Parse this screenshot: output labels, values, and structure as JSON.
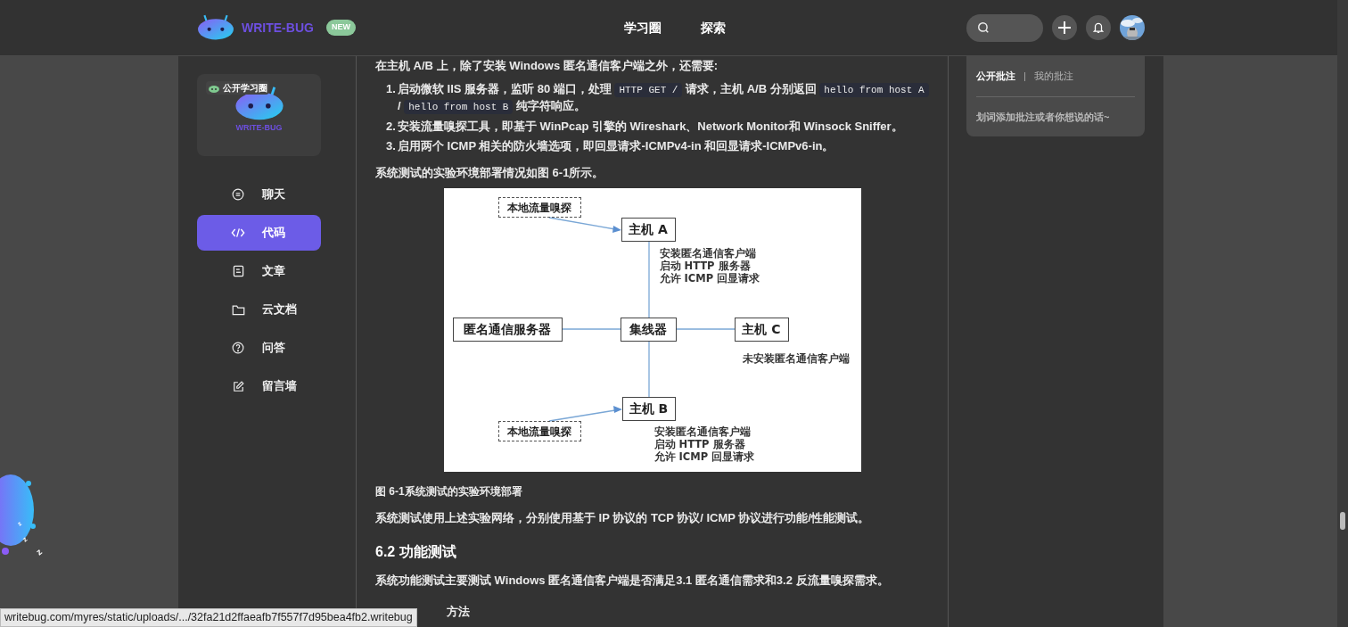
{
  "header": {
    "brand": "WRITE-BUG",
    "badge": "NEW",
    "nav": [
      {
        "label": "学习圈",
        "selected": false
      },
      {
        "label": "探索",
        "selected": false
      }
    ]
  },
  "sidebar": {
    "card": {
      "tag": "公开学习圈",
      "logo_text": "WRITE-BUG"
    },
    "items": [
      {
        "label": "聊天",
        "selected": false
      },
      {
        "label": "代码",
        "selected": true
      },
      {
        "label": "文章",
        "selected": false
      },
      {
        "label": "云文档",
        "selected": false
      },
      {
        "label": "问答",
        "selected": false
      },
      {
        "label": "留言墙",
        "selected": false
      }
    ]
  },
  "article": {
    "intro": "在主机 A/B 上，除了安装 Windows 匿名通信客户端之外，还需要:",
    "list": [
      {
        "number": "1.",
        "segments": [
          {
            "kind": "text",
            "text": "启动微软 IIS 服务器，监听 80 端口，处理 "
          },
          {
            "kind": "code",
            "text": "HTTP GET /"
          },
          {
            "kind": "text",
            "text": " 请求，主机 A/B 分别返回 "
          },
          {
            "kind": "code",
            "text": "hello from host A"
          },
          {
            "kind": "text",
            "text": " / "
          },
          {
            "kind": "code",
            "text": "hello from host B"
          },
          {
            "kind": "text",
            "text": " 纯字符响应。"
          }
        ]
      },
      {
        "number": "2.",
        "segments": [
          {
            "kind": "text",
            "text": "安装流量嗅探工具，即基于 WinPcap 引擎的 Wireshark、Network Monitor和 Winsock Sniffer。"
          }
        ]
      },
      {
        "number": "3.",
        "segments": [
          {
            "kind": "text",
            "text": "启用两个 ICMP 相关的防火墙选项，即回显请求-ICMPv4-in 和回显请求-ICMPv6-in。"
          }
        ]
      }
    ],
    "figure_ref": "系统测试的实验环境部署情况如图 6-1所示。",
    "diagram": {
      "nodes": [
        {
          "kind": "dashed",
          "label": "本地流量嗅探"
        },
        {
          "kind": "solid",
          "label": "主机 A"
        },
        {
          "kind": "solid",
          "label": "匿名通信服务器"
        },
        {
          "kind": "solid",
          "label": "集线器"
        },
        {
          "kind": "solid",
          "label": "主机 C"
        },
        {
          "kind": "solid",
          "label": "主机 B"
        },
        {
          "kind": "dashed",
          "label": "本地流量嗅探"
        }
      ],
      "notes": [
        [
          "安装匿名通信客户端",
          "启动 HTTP 服务器",
          "允许 ICMP 回显请求"
        ],
        [
          "未安装匿名通信客户端"
        ],
        [
          "安装匿名通信客户端",
          "启动 HTTP 服务器",
          "允许 ICMP 回显请求"
        ]
      ]
    },
    "caption": "图 6-1系统测试的实验环境部署",
    "para1": "系统测试使用上述实验网络，分别使用基于 IP 协议的 TCP 协议/ ICMP 协议进行功能/性能测试。",
    "heading": "6.2 功能测试",
    "para2": "系统功能测试主要测试 Windows 匿名通信客户端是否满足3.1 匿名通信需求和3.2 反流量嗅探需求。",
    "subheading": "方法"
  },
  "annotations": {
    "tabs": [
      {
        "label": "公开批注",
        "selected": true
      },
      {
        "label": "我的批注",
        "selected": false
      }
    ],
    "separator": "|",
    "placeholder": "划词添加批注或者你想说的话~"
  },
  "mascot": {
    "sleep_marks": [
      "z",
      "z",
      "z"
    ]
  },
  "status_bar": "writebug.com/myres/static/uploads/.../32fa21d2ffaeafb7f557f7d95bea4fb2.writebug"
}
